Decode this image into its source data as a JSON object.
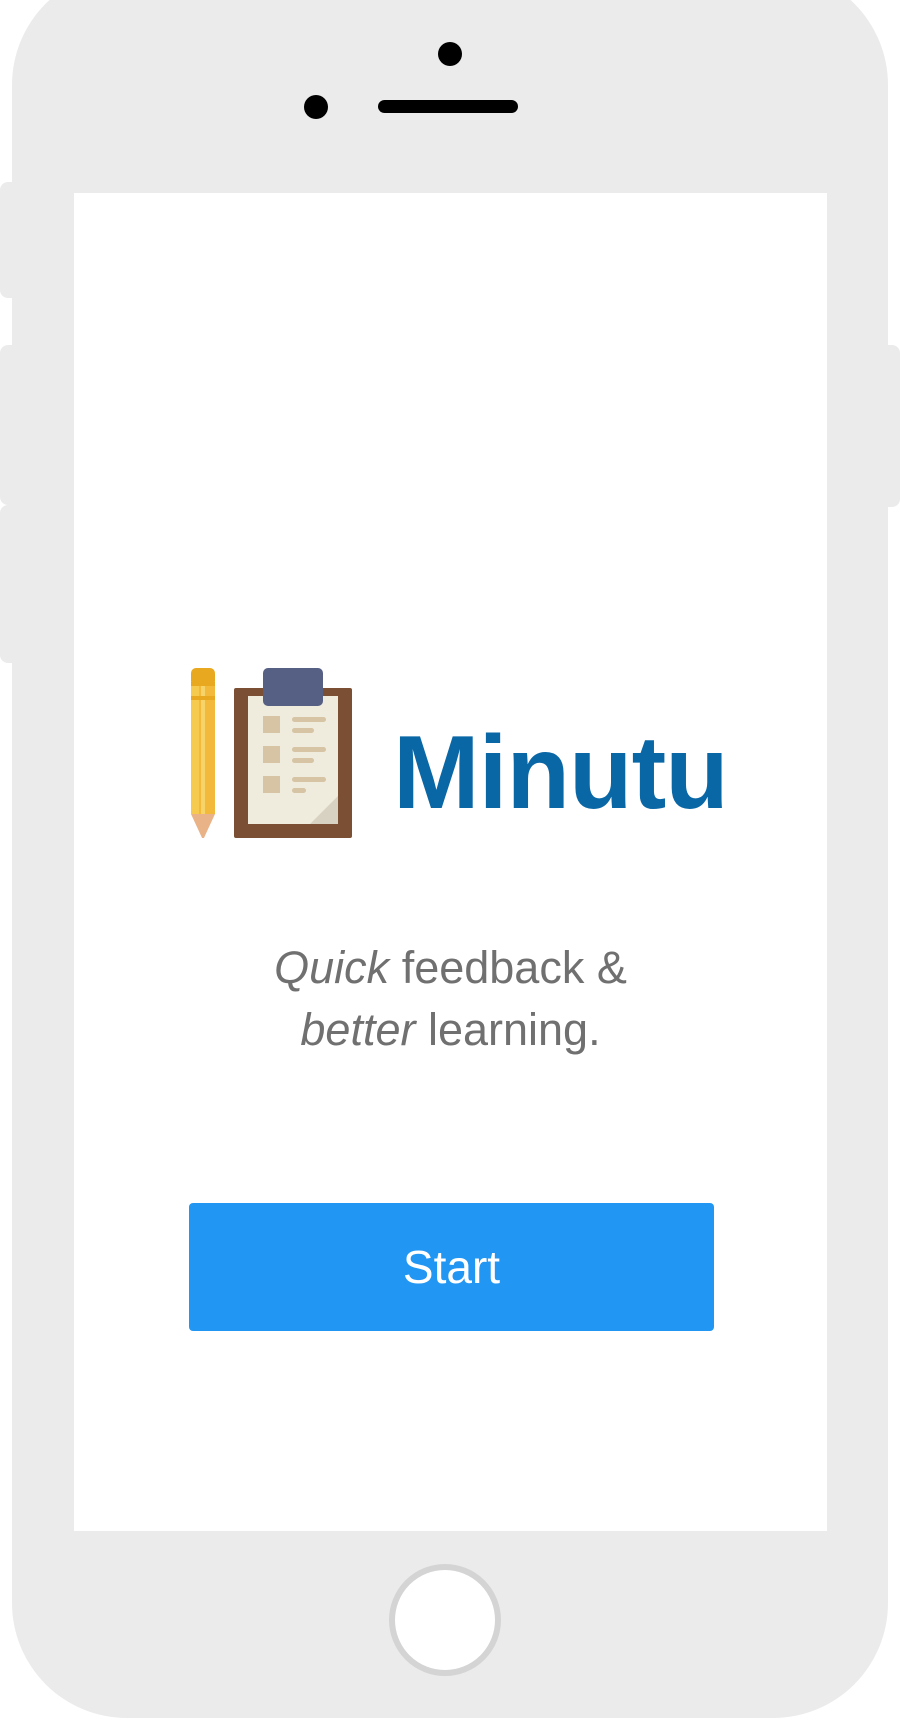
{
  "app": {
    "brand_name": "Minutu",
    "brand_color": "#0a67a6"
  },
  "tagline": {
    "line1_emphasis": "Quick",
    "line1_rest": " feedback &",
    "line2_emphasis": "better",
    "line2_rest": " learning."
  },
  "actions": {
    "start_label": "Start",
    "start_color": "#2196f3"
  },
  "icons": {
    "pencil": "pencil-icon",
    "clipboard": "clipboard-icon"
  },
  "device": {
    "frame_color": "#ebebeb"
  }
}
